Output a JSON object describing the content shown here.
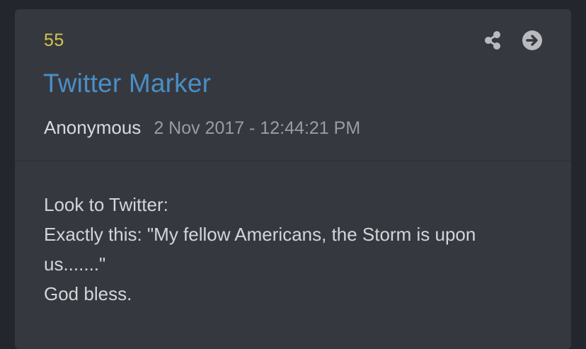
{
  "post": {
    "number": "55",
    "title": "Twitter Marker",
    "author": "Anonymous",
    "timestamp": "2 Nov 2017 - 12:44:21 PM",
    "body_lines": [
      "Look to Twitter:",
      "Exactly this: \"My fellow Americans, the Storm is upon",
      "us.......\"",
      "God bless."
    ]
  },
  "actions": {
    "share_icon": "share-icon",
    "open_icon": "arrow-circle-right-icon"
  },
  "colors": {
    "background": "#24262d",
    "card": "#363840",
    "post_number": "#d2c64a",
    "title": "#4a8fc4",
    "author": "#d9dadc",
    "timestamp": "#9a9ca3",
    "body_text": "#d4d5d8",
    "icon": "#b8babf"
  }
}
